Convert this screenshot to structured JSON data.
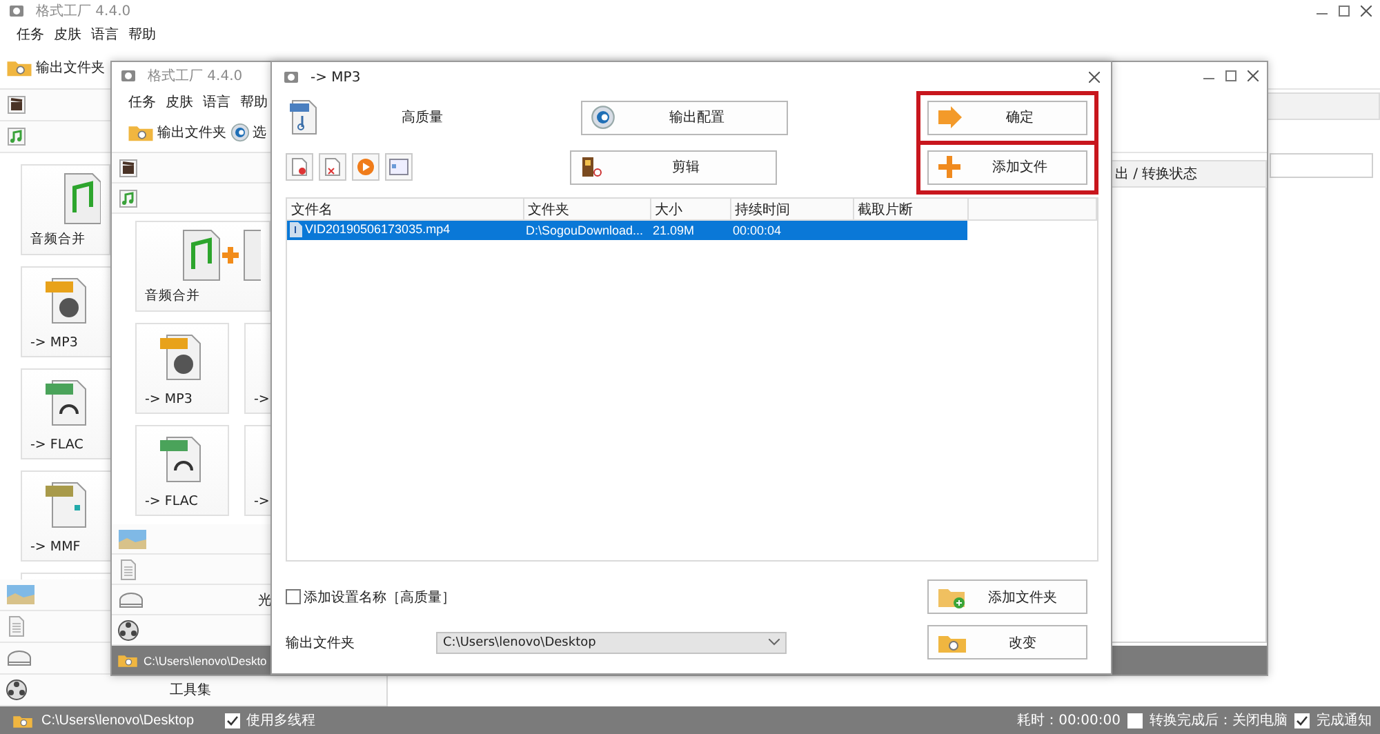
{
  "main_window": {
    "title": "格式工厂 4.4.0",
    "menu": [
      "任务",
      "皮肤",
      "语言",
      "帮助"
    ],
    "toolbar": [
      {
        "kind": "folder",
        "label": "输出文件夹"
      }
    ],
    "categories_top": [
      {
        "kind": "video"
      },
      {
        "kind": "audio"
      }
    ],
    "tiles": [
      {
        "kind": "merge",
        "label": "音频合并"
      },
      {
        "kind": "mp3",
        "label": "-> MP3"
      },
      {
        "kind": "flac",
        "label": "-> FLAC"
      },
      {
        "kind": "mmf",
        "label": "-> MMF"
      },
      {
        "kind": "blank"
      }
    ],
    "categories_bottom": [
      {
        "kind": "picture"
      },
      {
        "kind": "document"
      },
      {
        "kind": "disc"
      },
      {
        "kind": "tools",
        "label": "工具集"
      }
    ],
    "status_bar": {
      "path": "C:\\Users\\lenovo\\Desktop",
      "multithread": {
        "label": "使用多线程",
        "checked": true
      },
      "elapsed": "耗时：00:00:00",
      "shutdown": {
        "label": "转换完成后：关闭电脑",
        "checked": false
      },
      "notify": {
        "label": "完成通知",
        "checked": true
      }
    }
  },
  "second_window": {
    "title": "格式工厂 4.4.0",
    "menu": [
      "任务",
      "皮肤",
      "语言",
      "帮助"
    ],
    "toolbar": [
      {
        "kind": "folder",
        "label": "输出文件夹"
      },
      {
        "kind": "gear",
        "label": "选"
      }
    ],
    "categories_top": [
      {
        "kind": "video"
      },
      {
        "kind": "audio"
      }
    ],
    "tiles": [
      {
        "kind": "merge",
        "label": "音频合并"
      },
      {
        "kind": "mp3",
        "label": "-> MP3"
      },
      {
        "kind": "blank",
        "label": "->"
      },
      {
        "kind": "flac",
        "label": "-> FLAC"
      },
      {
        "kind": "blank",
        "label": "->"
      }
    ],
    "categories_bottom": [
      {
        "kind": "picture"
      },
      {
        "kind": "document"
      },
      {
        "kind": "disc",
        "label": "光"
      },
      {
        "kind": "tools"
      }
    ],
    "task_list_header": "出 / 转换状态",
    "status_bar": {
      "path": "C:\\Users\\lenovo\\Deskto"
    }
  },
  "dialog": {
    "title": "-> MP3",
    "preset": "高质量",
    "buttons": [
      {
        "kind": "config",
        "label": "输出配置",
        "highlighted": false
      },
      {
        "kind": "ok",
        "label": "确定",
        "highlighted": true
      },
      {
        "kind": "clip",
        "label": "剪辑",
        "highlighted": false
      },
      {
        "kind": "add",
        "label": "添加文件",
        "highlighted": true
      }
    ],
    "tools": [
      {
        "kind": "remove"
      },
      {
        "kind": "clear"
      },
      {
        "kind": "play"
      },
      {
        "kind": "info"
      }
    ],
    "table": {
      "columns": [
        "文件名",
        "文件夹",
        "大小",
        "持续时间",
        "截取片断"
      ],
      "rows": [
        {
          "cells": [
            "VID20190506173035.mp4",
            "D:\\SogouDownload...",
            "21.09M",
            "00:00:04",
            ""
          ],
          "selected": true
        }
      ]
    },
    "add_setting_name": {
      "label": "添加设置名称［高质量］",
      "checked": false
    },
    "add_folder": "添加文件夹",
    "output_folder_label": "输出文件夹",
    "output_folder": "C:\\Users\\lenovo\\Desktop",
    "change": "改变"
  }
}
